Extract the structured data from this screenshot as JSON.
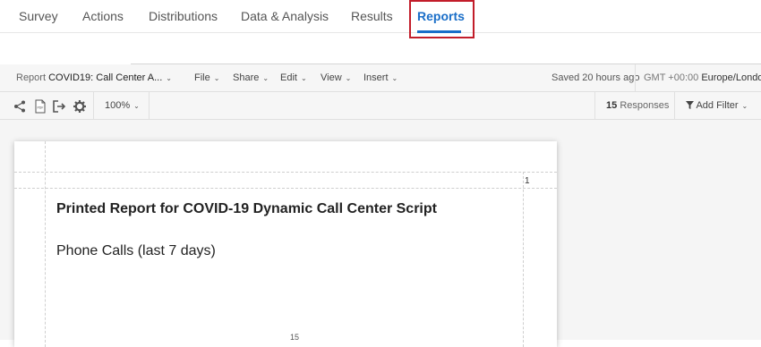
{
  "nav": {
    "tabs": [
      {
        "label": "Survey"
      },
      {
        "label": "Actions"
      },
      {
        "label": "Distributions"
      },
      {
        "label": "Data & Analysis"
      },
      {
        "label": "Results"
      },
      {
        "label": "Reports"
      }
    ],
    "active_tab": "Reports",
    "accent_color": "#1a6ec8",
    "highlight_color": "#c21d2a"
  },
  "menu": {
    "report_prefix": "Report",
    "report_name": "COVID19: Call Center A...",
    "items": [
      {
        "label": "File"
      },
      {
        "label": "Share"
      },
      {
        "label": "Edit"
      },
      {
        "label": "View"
      },
      {
        "label": "Insert"
      }
    ],
    "saved_status": "Saved 20 hours ago",
    "timezone_prefix": "GMT +00:00",
    "timezone_name": "Europe/London"
  },
  "toolbar": {
    "icons": [
      "share-nodes-icon",
      "pdf-icon",
      "export-icon",
      "settings-icon"
    ],
    "zoom": "100%",
    "responses_count": "15",
    "responses_label": "Responses",
    "add_filter_label": "Add Filter"
  },
  "page": {
    "page_number": "1",
    "title": "Printed Report for COVID-19 Dynamic Call Center Script",
    "chart_title": "Phone Calls (last 7 days)",
    "axis_tick": "15"
  }
}
